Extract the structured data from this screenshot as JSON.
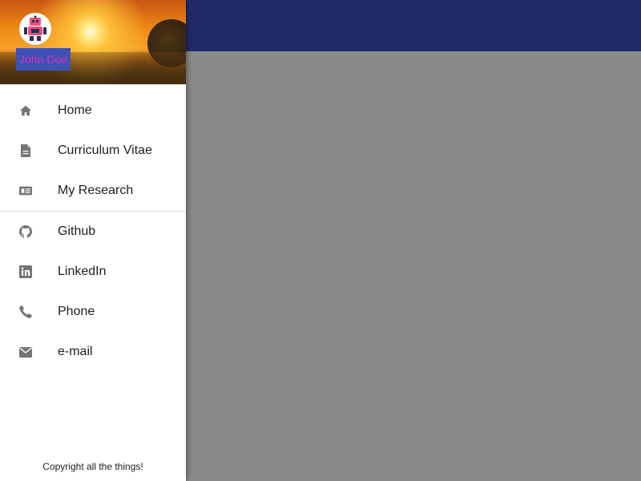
{
  "drawer": {
    "user_name": "John Doe",
    "avatar_icon": "robot-avatar-icon",
    "primary_items": [
      {
        "label": "Home",
        "icon": "home-icon"
      },
      {
        "label": "Curriculum Vitae",
        "icon": "document-icon"
      },
      {
        "label": "My Research",
        "icon": "newspaper-icon"
      }
    ],
    "secondary_items": [
      {
        "label": "Github",
        "icon": "github-icon"
      },
      {
        "label": "LinkedIn",
        "icon": "linkedin-icon"
      },
      {
        "label": "Phone",
        "icon": "phone-icon"
      },
      {
        "label": "e-mail",
        "icon": "envelope-icon"
      }
    ],
    "footer": "Copyright all the things!"
  },
  "colors": {
    "appbar": "#22296a",
    "backdrop": "#8a8a8a",
    "name_badge_bg": "#3f51b5",
    "name_badge_text": "#d32fb0",
    "icon": "#757575"
  }
}
